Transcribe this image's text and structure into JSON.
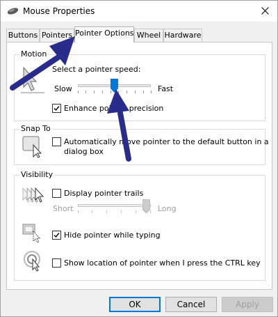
{
  "window": {
    "title": "Mouse Properties"
  },
  "tabs": [
    {
      "label": "Buttons",
      "active": false
    },
    {
      "label": "Pointers",
      "active": false
    },
    {
      "label": "Pointer Options",
      "active": true
    },
    {
      "label": "Wheel",
      "active": false
    },
    {
      "label": "Hardware",
      "active": false
    }
  ],
  "motion": {
    "title": "Motion",
    "speed_label": "Select a pointer speed:",
    "slow_label": "Slow",
    "fast_label": "Fast",
    "speed_level": 0.5,
    "enhance_label": "Enhance pointer precision",
    "enhance_checked": true
  },
  "snap_to": {
    "title": "Snap To",
    "label_line1": "Automatically move pointer to the default button in a",
    "label_line2": "dialog box",
    "checked": false
  },
  "visibility": {
    "title": "Visibility",
    "trails_label": "Display pointer trails",
    "trails_checked": false,
    "short_label": "Short",
    "long_label": "Long",
    "trails_length_level": 1.0,
    "hide_label": "Hide pointer while typing",
    "hide_checked": true,
    "ctrl_label": "Show location of pointer when I press the CTRL key",
    "ctrl_checked": false
  },
  "buttons": {
    "ok": "OK",
    "cancel": "Cancel",
    "apply": "Apply"
  },
  "colors": {
    "annotation_arrow": "#2a2c8c",
    "slider_thumb": "#0078d7",
    "default_button_border": "#0078d7"
  }
}
